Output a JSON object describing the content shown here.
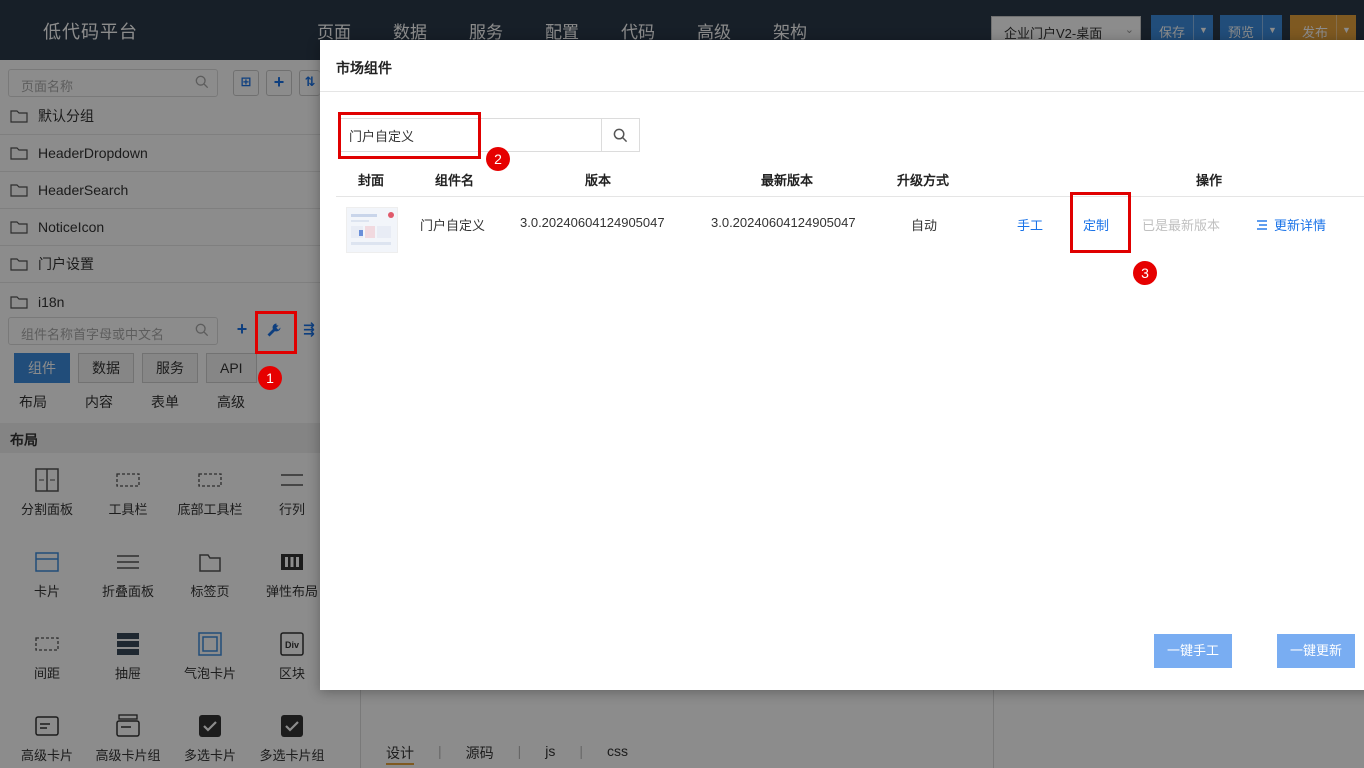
{
  "app": {
    "brand": "低代码平台"
  },
  "nav": [
    "页面",
    "数据",
    "服务",
    "配置",
    "代码",
    "高级",
    "架构"
  ],
  "project_select": {
    "value": "企业门户V2-桌面"
  },
  "toolbar": {
    "save_label": "保存",
    "preview_label": "预览",
    "publish_label": "发布"
  },
  "colors": {
    "topbar": "#2b3a4a",
    "save": "#3c8dde",
    "preview": "#3c8dde",
    "publish": "#e6a23c",
    "accent": "#1a73e8",
    "annotation": "#e00000"
  },
  "sidebar": {
    "page_search_placeholder": "页面名称",
    "groups": [
      "默认分组",
      "HeaderDropdown",
      "HeaderSearch",
      "NoticeIcon",
      "门户设置",
      "i18n"
    ],
    "component_search_placeholder": "组件名称首字母或中文名",
    "tabs": [
      "组件",
      "数据",
      "服务",
      "API"
    ],
    "subtabs": [
      "布局",
      "内容",
      "表单",
      "高级"
    ],
    "section_title": "布局",
    "components": [
      "分割面板",
      "工具栏",
      "底部工具栏",
      "行列",
      "卡片",
      "折叠面板",
      "标签页",
      "弹性布局",
      "间距",
      "抽屉",
      "气泡卡片",
      "区块",
      "高级卡片",
      "高级卡片组",
      "多选卡片",
      "多选卡片组"
    ]
  },
  "code_tabs": [
    "设计",
    "源码",
    "js",
    "css"
  ],
  "modal": {
    "title": "市场组件",
    "search_value": "门户自定义",
    "columns": [
      "封面",
      "组件名",
      "版本",
      "最新版本",
      "升级方式",
      "操作"
    ],
    "rows": [
      {
        "name": "门户自定义",
        "version": "3.0.20240604124905047",
        "latest_version": "3.0.20240604124905047",
        "upgrade_mode": "自动",
        "action_manual": "手工",
        "action_customize": "定制",
        "action_status": "已是最新版本",
        "action_detail": "更新详情"
      }
    ],
    "footer": {
      "manual_all": "一键手工",
      "update_all": "一键更新"
    }
  },
  "annotations": [
    "1",
    "2",
    "3"
  ]
}
